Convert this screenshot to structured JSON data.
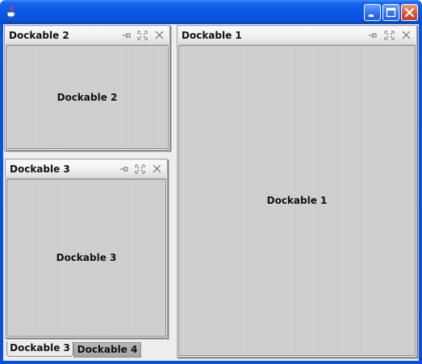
{
  "window": {
    "app_icon": "java-cup-icon",
    "controls": [
      "minimize-icon",
      "maximize-icon",
      "close-icon"
    ],
    "titlebar_color": "#0a58e6"
  },
  "panels": {
    "dockable2": {
      "title": "Dockable 2",
      "content": "Dockable 2"
    },
    "dockable3": {
      "title": "Dockable 3",
      "content": "Dockable 3"
    },
    "dockable1": {
      "title": "Dockable 1",
      "content": "Dockable 1"
    },
    "header_icons": [
      "minimize-panel-icon",
      "maximize-panel-icon",
      "close-panel-icon"
    ]
  },
  "tabs": [
    {
      "label": "Dockable 3",
      "selected": true
    },
    {
      "label": "Dockable 4",
      "selected": false
    }
  ]
}
